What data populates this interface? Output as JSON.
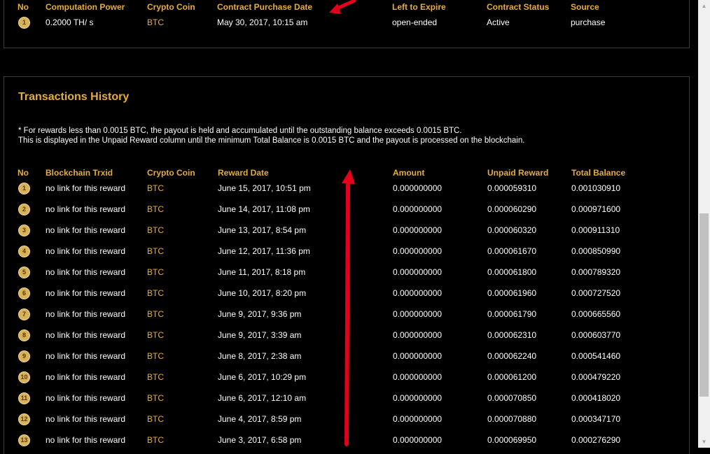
{
  "contracts": {
    "headers": {
      "no": "No",
      "power": "Computation Power",
      "coin": "Crypto Coin",
      "date": "Contract Purchase Date",
      "expire": "Left to Expire",
      "status": "Contract Status",
      "source": "Source"
    },
    "rows": [
      {
        "no": "1",
        "power": "0.2000 TH/ s",
        "coin": "BTC",
        "date": "May 30, 2017, 10:15 am",
        "expire": "open-ended",
        "status": "Active",
        "source": "purchase"
      }
    ]
  },
  "history": {
    "title": "Transactions History",
    "note_line1": "* For rewards less than 0.0015 BTC, the payout is held and accumulated until the outstanding balance exceeds 0.0015 BTC.",
    "note_line2": "This is displayed in the Unpaid Reward column until the minimum Total Balance is 0.0015 BTC and the payout is processed on the blockchain.",
    "headers": {
      "no": "No",
      "trxid": "Blockchain Trxid",
      "coin": "Crypto Coin",
      "date": "Reward Date",
      "amount": "Amount",
      "unpaid": "Unpaid Reward",
      "total": "Total Balance"
    },
    "rows": [
      {
        "no": "1",
        "trxid": "no link for this reward",
        "coin": "BTC",
        "date": "June 15, 2017, 10:51 pm",
        "amount": "0.000000000",
        "unpaid": "0.000059310",
        "total": "0.001030910"
      },
      {
        "no": "2",
        "trxid": "no link for this reward",
        "coin": "BTC",
        "date": "June 14, 2017, 11:08 pm",
        "amount": "0.000000000",
        "unpaid": "0.000060290",
        "total": "0.000971600"
      },
      {
        "no": "3",
        "trxid": "no link for this reward",
        "coin": "BTC",
        "date": "June 13, 2017, 8:54 pm",
        "amount": "0.000000000",
        "unpaid": "0.000060320",
        "total": "0.000911310"
      },
      {
        "no": "4",
        "trxid": "no link for this reward",
        "coin": "BTC",
        "date": "June 12, 2017, 11:36 pm",
        "amount": "0.000000000",
        "unpaid": "0.000061670",
        "total": "0.000850990"
      },
      {
        "no": "5",
        "trxid": "no link for this reward",
        "coin": "BTC",
        "date": "June 11, 2017, 8:18 pm",
        "amount": "0.000000000",
        "unpaid": "0.000061800",
        "total": "0.000789320"
      },
      {
        "no": "6",
        "trxid": "no link for this reward",
        "coin": "BTC",
        "date": "June 10, 2017, 8:20 pm",
        "amount": "0.000000000",
        "unpaid": "0.000061960",
        "total": "0.000727520"
      },
      {
        "no": "7",
        "trxid": "no link for this reward",
        "coin": "BTC",
        "date": "June 9, 2017, 9:36 pm",
        "amount": "0.000000000",
        "unpaid": "0.000061790",
        "total": "0.000665560"
      },
      {
        "no": "8",
        "trxid": "no link for this reward",
        "coin": "BTC",
        "date": "June 9, 2017, 3:39 am",
        "amount": "0.000000000",
        "unpaid": "0.000062310",
        "total": "0.000603770"
      },
      {
        "no": "9",
        "trxid": "no link for this reward",
        "coin": "BTC",
        "date": "June 8, 2017, 2:38 am",
        "amount": "0.000000000",
        "unpaid": "0.000062240",
        "total": "0.000541460"
      },
      {
        "no": "10",
        "trxid": "no link for this reward",
        "coin": "BTC",
        "date": "June 6, 2017, 10:29 pm",
        "amount": "0.000000000",
        "unpaid": "0.000061200",
        "total": "0.000479220"
      },
      {
        "no": "11",
        "trxid": "no link for this reward",
        "coin": "BTC",
        "date": "June 6, 2017, 12:10 am",
        "amount": "0.000000000",
        "unpaid": "0.000070850",
        "total": "0.000418020"
      },
      {
        "no": "12",
        "trxid": "no link for this reward",
        "coin": "BTC",
        "date": "June 4, 2017, 8:59 pm",
        "amount": "0.000000000",
        "unpaid": "0.000070880",
        "total": "0.000347170"
      },
      {
        "no": "13",
        "trxid": "no link for this reward",
        "coin": "BTC",
        "date": "June 3, 2017, 6:58 pm",
        "amount": "0.000000000",
        "unpaid": "0.000069950",
        "total": "0.000276290"
      }
    ]
  },
  "colors": {
    "accent": "#e5ad3e",
    "annotation_arrow": "#e3001b",
    "badge": "#d8b25a"
  },
  "icons": {
    "annotation": "red-arrow-icon",
    "scroll_up": "scroll-up-arrow-icon",
    "scroll_down": "scroll-down-arrow-icon"
  }
}
